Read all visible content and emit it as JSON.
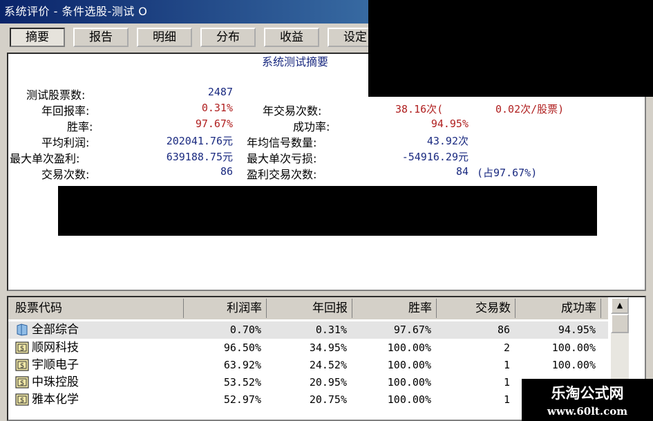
{
  "window": {
    "title": "系统评价 - 条件选股-测试 O"
  },
  "tabs": [
    {
      "label": "摘要",
      "active": true
    },
    {
      "label": "报告",
      "active": false
    },
    {
      "label": "明细",
      "active": false
    },
    {
      "label": "分布",
      "active": false
    },
    {
      "label": "收益",
      "active": false
    },
    {
      "label": "设定",
      "active": false
    }
  ],
  "summary": {
    "title": "系统测试摘要",
    "test_stock_count": {
      "label": "测试股票数:",
      "value": "2487"
    },
    "annual_return": {
      "label": "年回报率:",
      "value": "0.31%"
    },
    "annual_trades": {
      "label": "年交易次数:",
      "value": "38.16次(",
      "extra": "0.02次/股票)"
    },
    "win_rate": {
      "label": "胜率:",
      "value": "97.67%"
    },
    "success_rate": {
      "label": "成功率:",
      "value": "94.95%"
    },
    "avg_profit": {
      "label": "平均利润:",
      "value": "202041.76元"
    },
    "annual_signals": {
      "label": "年均信号数量:",
      "value": "43.92次"
    },
    "max_single_profit": {
      "label": "最大单次盈利:",
      "value": "639188.75元"
    },
    "max_single_loss": {
      "label": "最大单次亏损:",
      "value": "-54916.29元"
    },
    "trade_count": {
      "label": "交易次数:",
      "value": "86"
    },
    "profit_trades": {
      "label": "盈利交易次数:",
      "value": "84",
      "extra": "(占97.67%)"
    }
  },
  "table": {
    "headers": [
      "股票代码",
      "利润率",
      "年回报",
      "胜率",
      "交易数",
      "成功率"
    ],
    "rows": [
      {
        "name": "全部综合",
        "icon": "folder-icon",
        "profit_rate": "0.70%",
        "annual_return": "0.31%",
        "win_rate": "97.67%",
        "trades": "86",
        "success_rate": "94.95%"
      },
      {
        "name": "顺网科技",
        "icon": "stock-icon",
        "profit_rate": "96.50%",
        "annual_return": "34.95%",
        "win_rate": "100.00%",
        "trades": "2",
        "success_rate": "100.00%"
      },
      {
        "name": "宇顺电子",
        "icon": "stock-icon",
        "profit_rate": "63.92%",
        "annual_return": "24.52%",
        "win_rate": "100.00%",
        "trades": "1",
        "success_rate": "100.00%"
      },
      {
        "name": "中珠控股",
        "icon": "stock-icon",
        "profit_rate": "53.52%",
        "annual_return": "20.95%",
        "win_rate": "100.00%",
        "trades": "1",
        "success_rate": ""
      },
      {
        "name": "雅本化学",
        "icon": "stock-icon",
        "profit_rate": "52.97%",
        "annual_return": "20.75%",
        "win_rate": "100.00%",
        "trades": "1",
        "success_rate": ""
      }
    ]
  },
  "watermark": {
    "title": "乐淘公式网",
    "url": "www.60lt.com"
  },
  "colors": {
    "label_blue": "#1a2a80",
    "value_red": "#b02020",
    "title_bar": "#0a246a"
  }
}
